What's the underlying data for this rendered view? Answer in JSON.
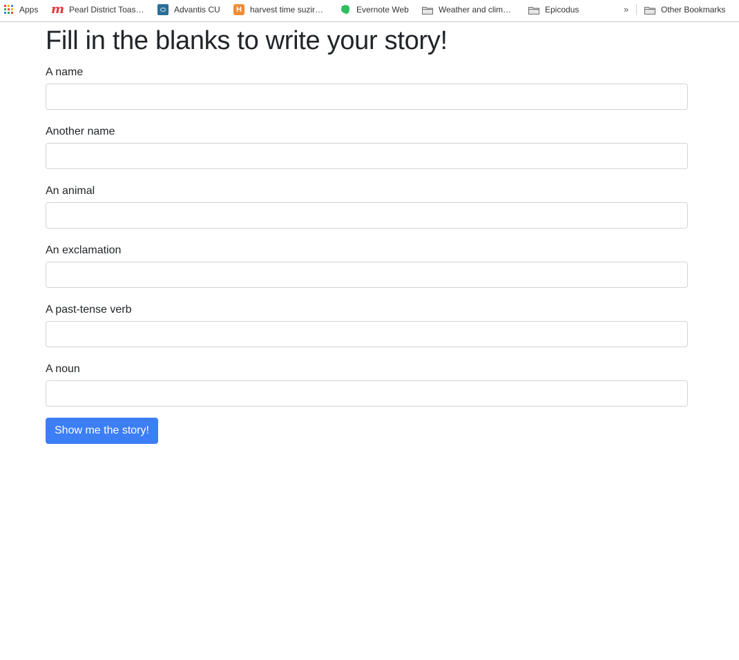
{
  "bookmarks": {
    "apps": "Apps",
    "items": [
      {
        "label": "Pearl District Toas…",
        "icon": "meetup-icon"
      },
      {
        "label": "Advantis CU",
        "icon": "advantis-icon"
      },
      {
        "label": "harvest time suzir…",
        "icon": "harvest-icon",
        "icon_text": "H"
      },
      {
        "label": "Evernote Web",
        "icon": "evernote-icon"
      },
      {
        "label": "Weather and clim…",
        "icon": "folder-icon"
      },
      {
        "label": "Epicodus",
        "icon": "folder-icon"
      }
    ],
    "overflow": "»",
    "other": "Other Bookmarks"
  },
  "page": {
    "title": "Fill in the blanks to write your story!",
    "fields": [
      {
        "label": "A name",
        "value": ""
      },
      {
        "label": "Another name",
        "value": ""
      },
      {
        "label": "An animal",
        "value": ""
      },
      {
        "label": "An exclamation",
        "value": ""
      },
      {
        "label": "A past-tense verb",
        "value": ""
      },
      {
        "label": "A noun",
        "value": ""
      }
    ],
    "submit_label": "Show me the story!"
  },
  "colors": {
    "primary_button": "#3c7ef5",
    "input_border": "#ced4da",
    "text": "#212529",
    "meetup": "#e0393e",
    "advantis": "#2b6f98",
    "harvest": "#f28b30",
    "evernote": "#2dbe60"
  }
}
